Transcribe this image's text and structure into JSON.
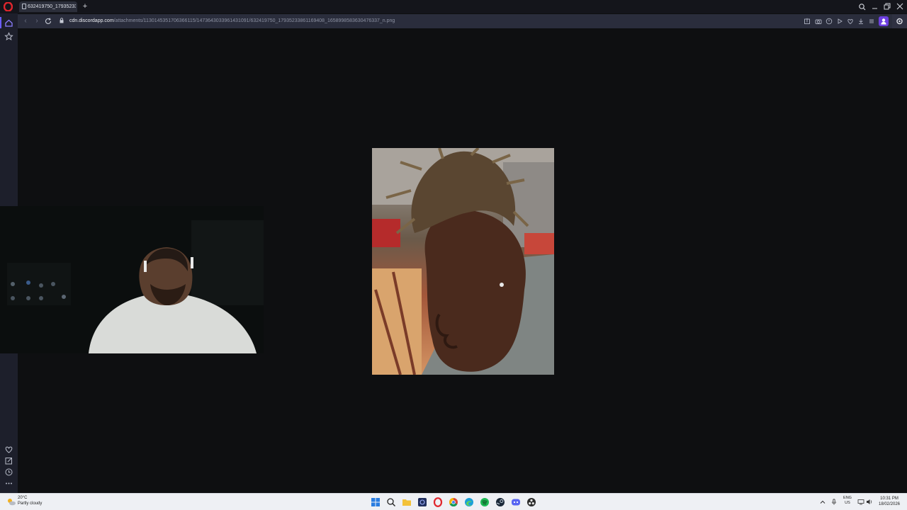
{
  "browser": {
    "tab": {
      "title": "632419750_1793523386"
    },
    "address": {
      "host": "cdn.discordapp.com",
      "path": "/attachments/1130145351706366115/1473643033961431091/632419750_17935233861169408_1658998583630476337_n.png"
    }
  },
  "taskbar": {
    "weather": {
      "temperature": "20°C",
      "description": "Partly cloudy"
    },
    "language": {
      "code": "ENG",
      "region": "US"
    },
    "clock": {
      "time": "10:31 PM",
      "date": "18/02/2026"
    }
  },
  "icons": {
    "sidebar": [
      "home-icon",
      "star-icon",
      "heart-icon",
      "pinboard-icon",
      "history-icon",
      "more-icon"
    ],
    "toolbar": [
      "share-icon",
      "camera-icon",
      "reader-icon",
      "play-icon",
      "heart-icon",
      "download-icon",
      "easy-setup-icon"
    ],
    "taskbar": [
      "start-icon",
      "search-icon",
      "file-explorer-icon",
      "app-icon",
      "opera-icon",
      "chrome-icon",
      "edge-icon",
      "spotify-icon",
      "steam-icon",
      "discord-icon",
      "obs-icon"
    ]
  },
  "colors": {
    "accent": "#6b5cff",
    "opera_red": "#e0262d",
    "profile": "#6d3fe0"
  }
}
